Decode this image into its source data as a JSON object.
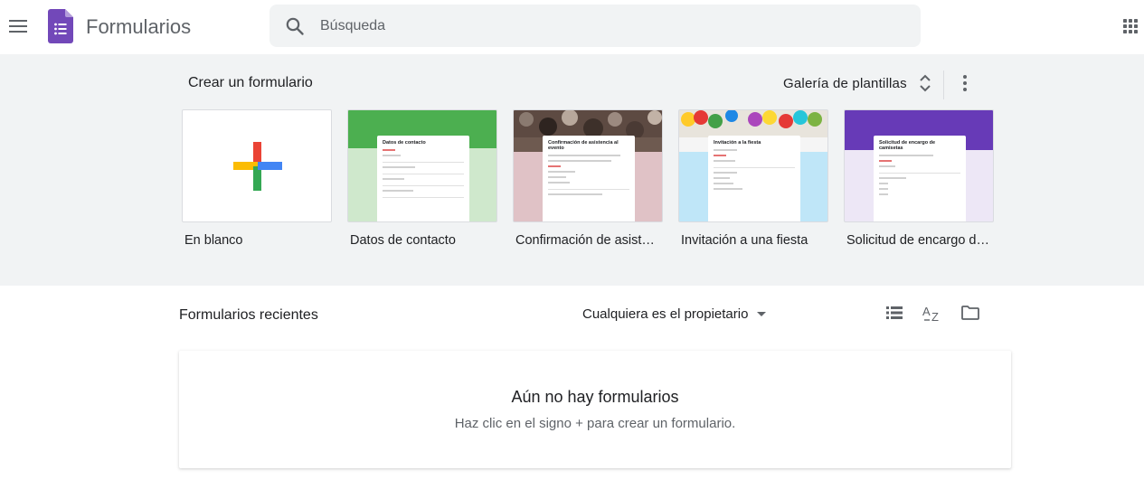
{
  "header": {
    "app_title": "Formularios",
    "search_placeholder": "Búsqueda",
    "brand_color": "#7248b9"
  },
  "gallery": {
    "create_title": "Crear un formulario",
    "gallery_button_label": "Galería de plantillas",
    "templates": [
      {
        "label": "En blanco",
        "kind": "blank"
      },
      {
        "label": "Datos de contacto",
        "kind": "contact",
        "header_color": "#4caf50",
        "bg_color": "#cfe8cc",
        "form_title": "Datos de contacto"
      },
      {
        "label": "Confirmación de asist…",
        "kind": "rsvp",
        "bg_color": "#e0c2c6",
        "form_title": "Confirmación de asistencia al evento"
      },
      {
        "label": "Invitación a una fiesta",
        "kind": "party",
        "bg_color": "#bfe6f8",
        "form_title": "Invitación a la fiesta"
      },
      {
        "label": "Solicitud de encargo d…",
        "kind": "tshirt",
        "header_color": "#673ab7",
        "bg_color": "#ede7f6",
        "form_title": "Solicitud de encargo de camisetas"
      }
    ]
  },
  "recent": {
    "title": "Formularios recientes",
    "owner_filter": "Cualquiera es el propietario",
    "empty_title": "Aún no hay formularios",
    "empty_subtitle": "Haz clic en el signo + para crear un formulario."
  }
}
